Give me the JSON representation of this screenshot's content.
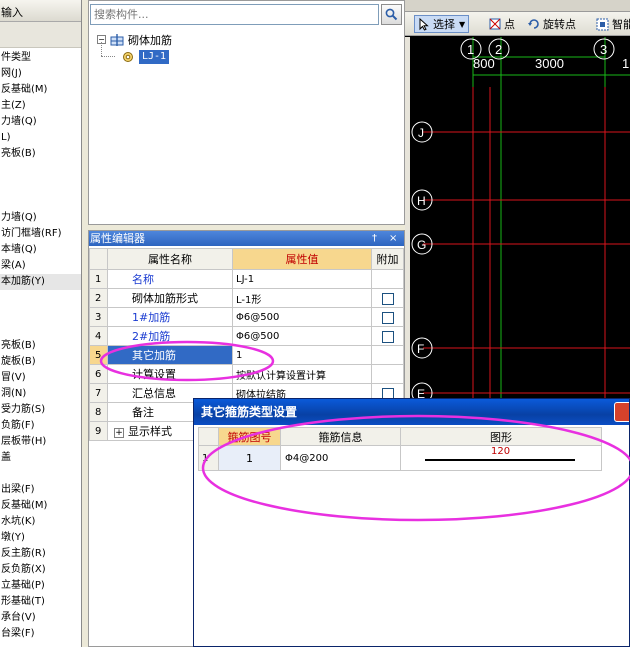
{
  "left_panel": {
    "header": "输入",
    "items": [
      "件类型",
      "网(J)",
      "反基础(M)",
      "主(Z)",
      "力墙(Q)",
      "L)",
      "亮板(B)",
      "",
      "",
      "",
      "力墙(Q)",
      "访门框墙(RF)",
      "本墙(Q)",
      "梁(A)",
      "本加筋(Y)",
      "",
      "",
      "",
      "亮板(B)",
      "旋板(B)",
      "冒(V)",
      "洞(N)",
      "受力筋(S)",
      "负筋(F)",
      "层板带(H)",
      "盖",
      "",
      "出梁(F)",
      "反基础(M)",
      "水坑(K)",
      "墩(Y)",
      "反主筋(R)",
      "反负筋(X)",
      "立基础(P)",
      "形基础(T)",
      "承台(V)",
      "台梁(F)"
    ],
    "selected_index": 14
  },
  "search": {
    "placeholder": "搜索构件..."
  },
  "tree": {
    "root_label": "砌体加筋",
    "child_label": "LJ-1"
  },
  "property_editor": {
    "title": "属性编辑器",
    "pin_glyph": "†",
    "close_glyph": "×",
    "headers": {
      "name": "属性名称",
      "value": "属性值",
      "extra": "附加"
    },
    "rows": [
      {
        "num": "1",
        "name": "名称",
        "value": "LJ-1",
        "blue": true,
        "checkbox": false
      },
      {
        "num": "2",
        "name": "砌体加筋形式",
        "value": "L-1形",
        "blue": false,
        "checkbox": true
      },
      {
        "num": "3",
        "name": "1#加筋",
        "value": "Φ6@500",
        "blue": true,
        "checkbox": true
      },
      {
        "num": "4",
        "name": "2#加筋",
        "value": "Φ6@500",
        "blue": true,
        "checkbox": true
      },
      {
        "num": "5",
        "name": "其它加筋",
        "value": "1",
        "blue": false,
        "checkbox": false,
        "selected": true
      },
      {
        "num": "6",
        "name": "计算设置",
        "value": "按默认计算设置计算",
        "blue": false,
        "checkbox": false
      },
      {
        "num": "7",
        "name": "汇总信息",
        "value": "砌体拉结筋",
        "blue": false,
        "checkbox": true
      },
      {
        "num": "8",
        "name": "备注",
        "value": "",
        "blue": false,
        "checkbox": false
      },
      {
        "num": "9",
        "name": "显示样式",
        "value": "",
        "blue": false,
        "checkbox": false,
        "expandable": true
      }
    ]
  },
  "cad": {
    "toolbar": {
      "select": "选择",
      "point": "点",
      "rotate_point": "旋转点",
      "smart": "智能"
    },
    "axis_top": [
      "1",
      "2",
      "3"
    ],
    "dims": [
      "800",
      "3000",
      "1"
    ],
    "axis_left": [
      "J",
      "H",
      "G",
      "F",
      "E"
    ],
    "colors": {
      "grid_green": "#18b818",
      "grid_red": "#d8141c",
      "bubble": "#ffffff"
    }
  },
  "dialog": {
    "title": "其它箍筋类型设置",
    "headers": {
      "code": "箍筋图号",
      "info": "箍筋信息",
      "shape": "图形"
    },
    "row": {
      "index": "1",
      "code": "1",
      "info": "Φ4@200",
      "shape_value": "120"
    }
  },
  "colors": {
    "title_blue": "#2d64bf",
    "selection_blue": "#316ac5",
    "header_gold": "#f7d78e",
    "annotation_magenta": "#e830e0"
  }
}
